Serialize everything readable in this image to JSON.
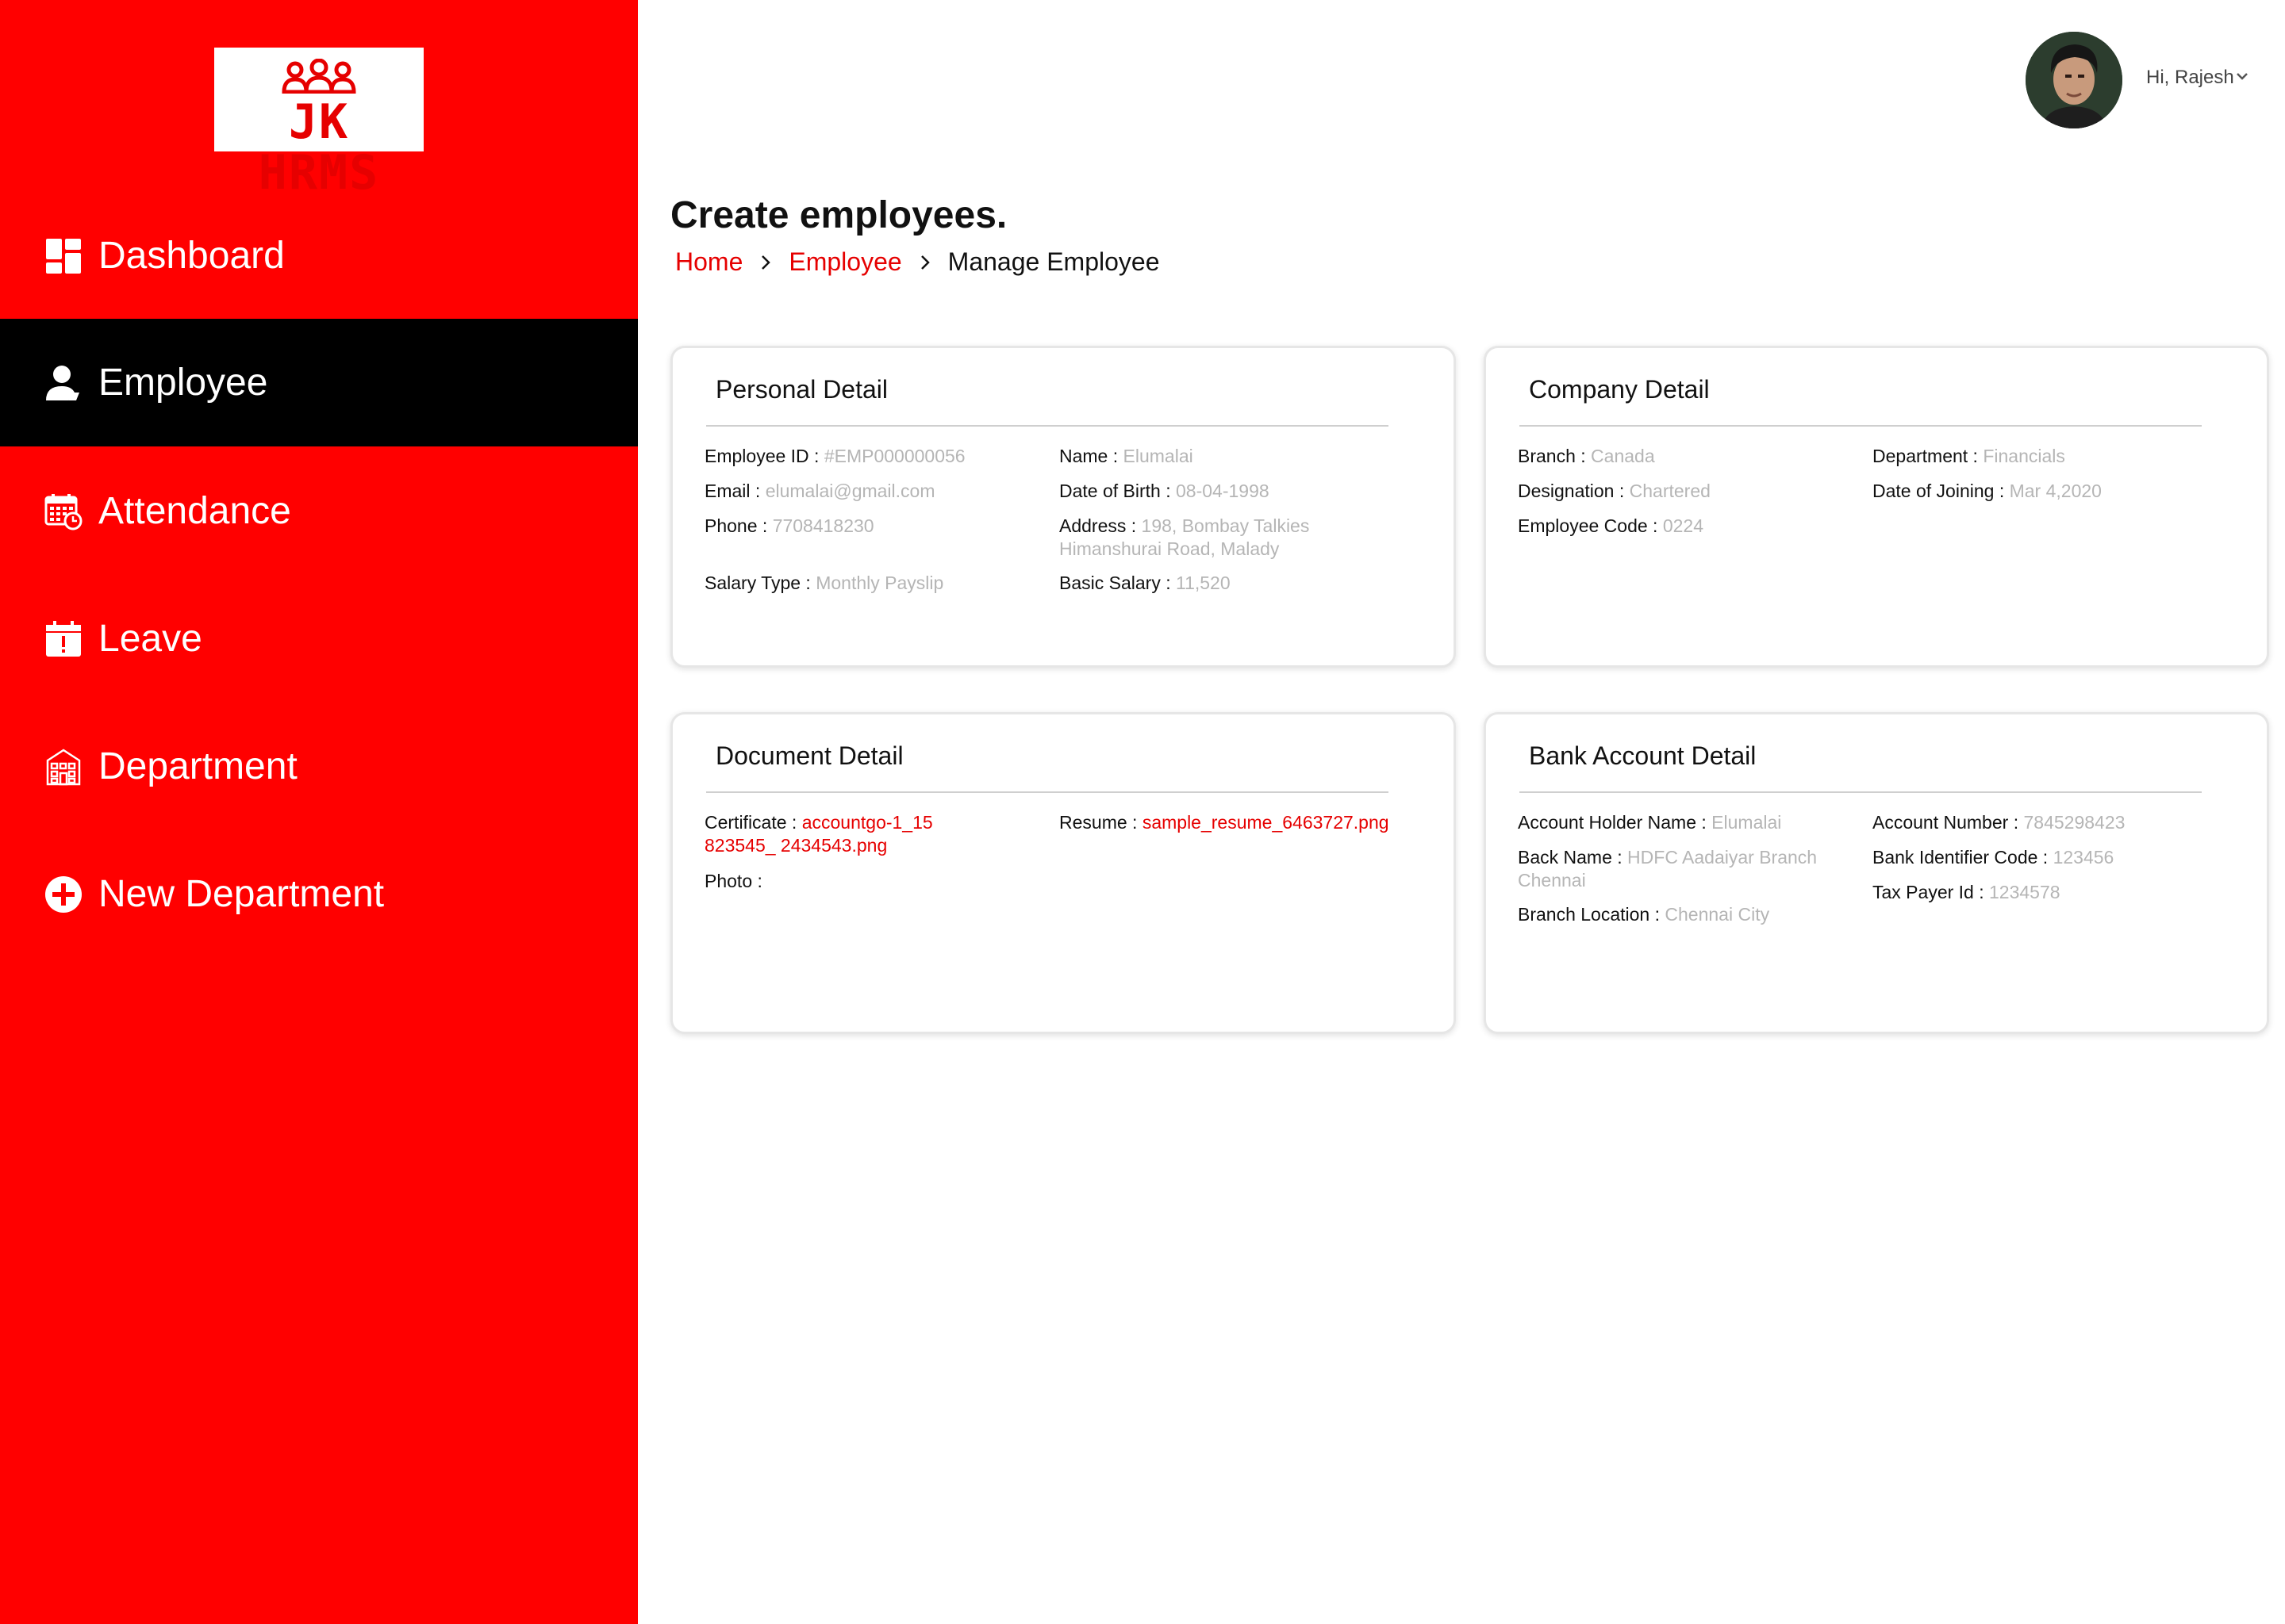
{
  "app": {
    "logo_text": "JK HRMS",
    "accent_color": "#ff0000",
    "active_color": "#000000"
  },
  "sidebar": {
    "items": [
      {
        "label": "Dashboard",
        "icon": "dashboard-icon"
      },
      {
        "label": "Employee",
        "icon": "user-icon",
        "active": true
      },
      {
        "label": "Attendance",
        "icon": "calendar-clock-icon"
      },
      {
        "label": "Leave",
        "icon": "calendar-alert-icon"
      },
      {
        "label": "Department",
        "icon": "building-icon"
      },
      {
        "label": "New Department",
        "icon": "plus-circle-icon"
      }
    ]
  },
  "header": {
    "greeting": "Hi, Rajesh"
  },
  "page": {
    "title": "Create employees.",
    "breadcrumb": {
      "home": "Home",
      "employee": "Employee",
      "current": "Manage Employee"
    }
  },
  "personal": {
    "title": "Personal Detail",
    "employee_id_label": "Employee ID :",
    "employee_id": "#EMP000000056",
    "name_label": "Name :",
    "name": "Elumalai",
    "email_label": "Email :",
    "email": "elumalai@gmail.com",
    "dob_label": "Date of Birth :",
    "dob": "08-04-1998",
    "phone_label": "Phone :",
    "phone": "7708418230",
    "address_label": "Address :",
    "address_line1": "198, Bombay Talkies",
    "address_line2": "Himanshurai Road, Malady",
    "salary_type_label": "Salary Type :",
    "salary_type": "Monthly Payslip",
    "basic_salary_label": "Basic Salary :",
    "basic_salary": "11,520"
  },
  "company": {
    "title": "Company Detail",
    "branch_label": "Branch :",
    "branch": "Canada",
    "department_label": "Department :",
    "department": "Financials",
    "designation_label": "Designation :",
    "designation": "Chartered",
    "doj_label": "Date of Joining :",
    "doj": "Mar 4,2020",
    "employee_code_label": "Employee Code :",
    "employee_code": "0224"
  },
  "document": {
    "title": "Document Detail",
    "certificate_label": "Certificate :",
    "certificate_line1": "accountgo-1_15",
    "certificate_line2": "823545_ 2434543.png",
    "resume_label": "Resume :",
    "resume": "sample_resume_6463727.png",
    "photo_label": "Photo :"
  },
  "bank": {
    "title": "Bank Account Detail",
    "holder_label": "Account Holder Name :",
    "holder": "Elumalai",
    "account_number_label": "Account Number :",
    "account_number": "7845298423",
    "bank_name_label": "Back Name :",
    "bank_name_line1": "HDFC Aadaiyar Branch",
    "bank_name_line2": "Chennai",
    "bic_label": "Bank Identifier Code :",
    "bic": "123456",
    "tax_label": "Tax Payer Id :",
    "tax": "1234578",
    "branch_location_label": "Branch Location :",
    "branch_location": "Chennai City"
  }
}
